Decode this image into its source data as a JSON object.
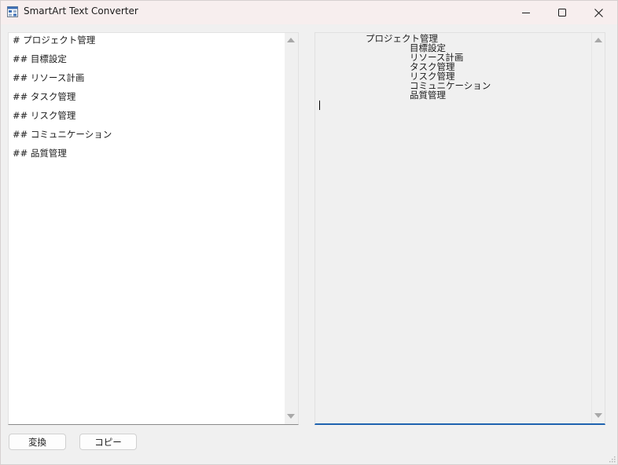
{
  "window": {
    "title": "SmartArt Text Converter"
  },
  "icons": {
    "app": "app-window-icon",
    "minimize": "minimize-icon",
    "maximize": "maximize-icon",
    "close": "close-icon"
  },
  "input": {
    "lines": [
      "# プロジェクト管理",
      "## 目標設定",
      "## リソース計画",
      "## タスク管理",
      "## リスク管理",
      "## コミュニケーション",
      "## 品質管理"
    ]
  },
  "output": {
    "lines": [
      {
        "text": "プロジェクト管理",
        "level": 1
      },
      {
        "text": "目標設定",
        "level": 2
      },
      {
        "text": "リソース計画",
        "level": 2
      },
      {
        "text": "タスク管理",
        "level": 2
      },
      {
        "text": "リスク管理",
        "level": 2
      },
      {
        "text": "コミュニケーション",
        "level": 2
      },
      {
        "text": "品質管理",
        "level": 2
      }
    ]
  },
  "buttons": {
    "convert_label": "変換",
    "copy_label": "コピー"
  },
  "colors": {
    "focus_accent": "#1f63b0",
    "titlebar": "#f7eeee"
  }
}
